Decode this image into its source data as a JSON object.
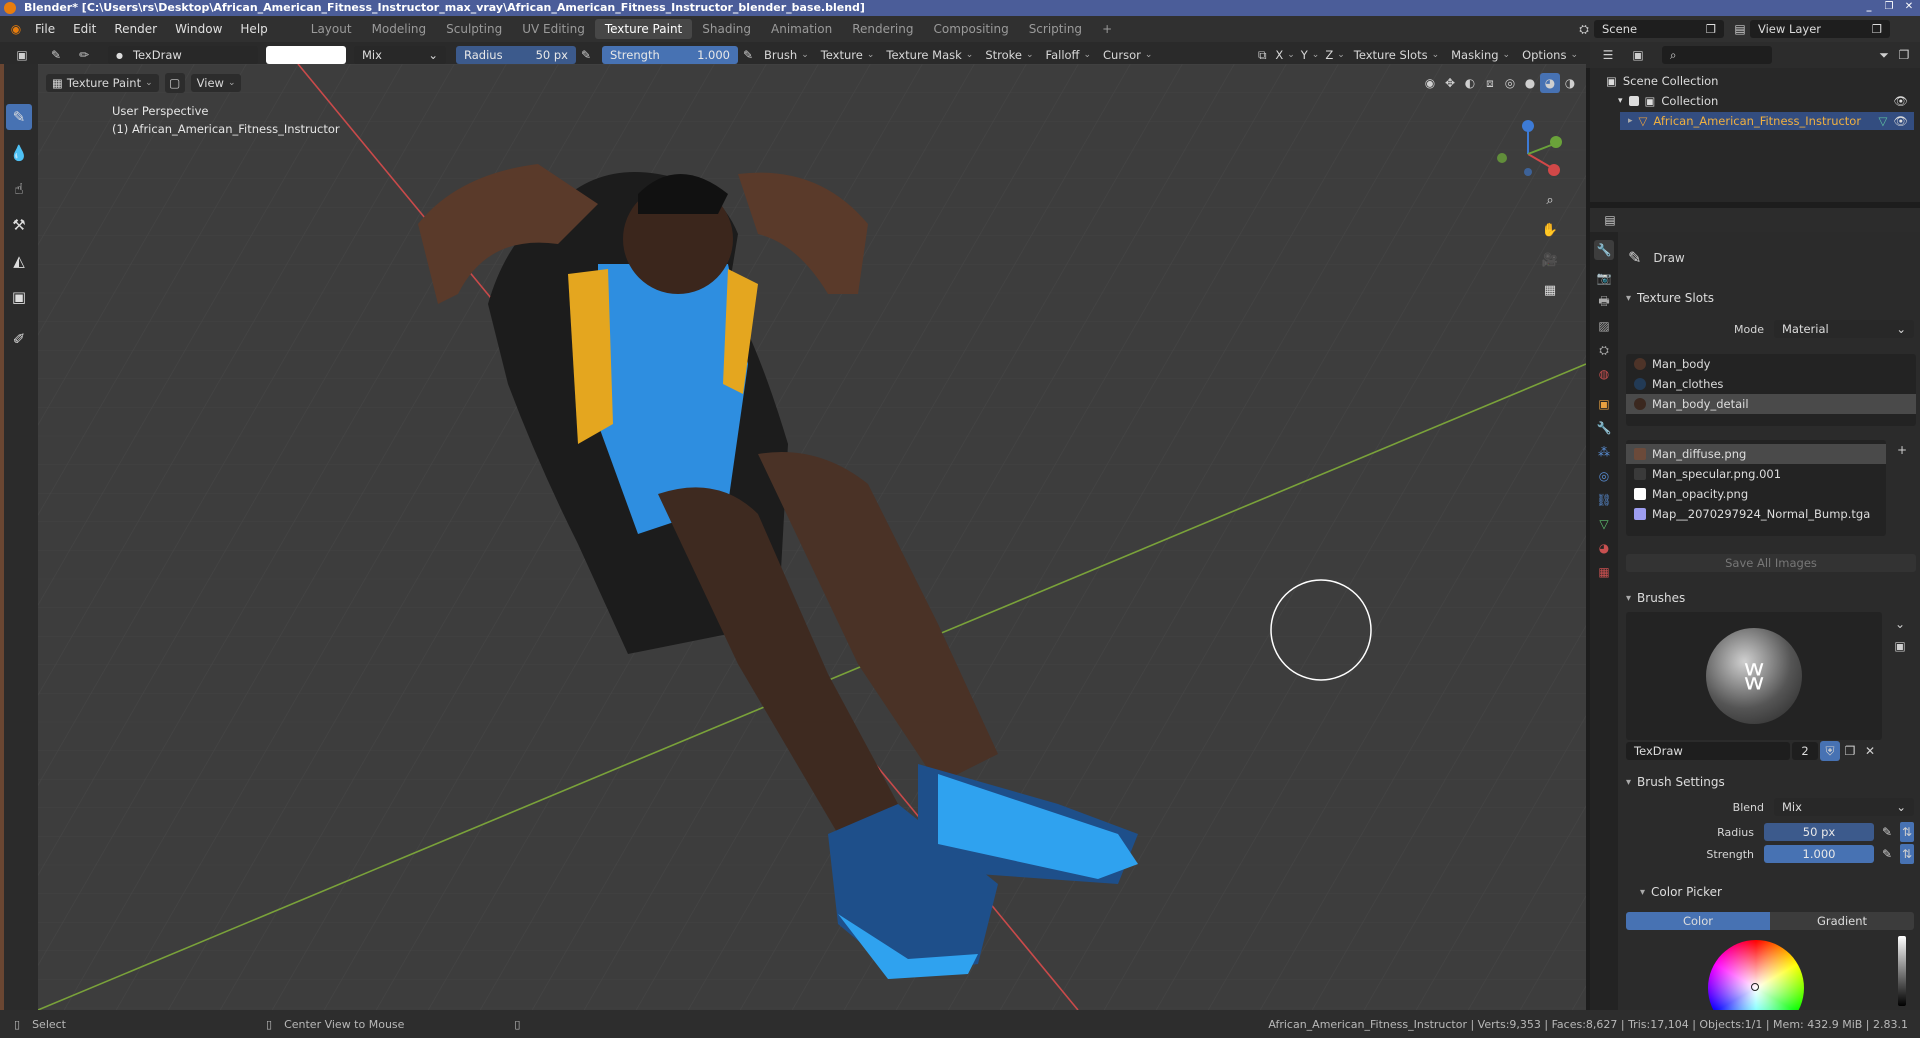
{
  "window": {
    "title": "Blender* [C:\\Users\\rs\\Desktop\\African_American_Fitness_Instructor_max_vray\\African_American_Fitness_Instructor_blender_base.blend]",
    "controls": [
      "_",
      "❐",
      "✕"
    ]
  },
  "menubar": {
    "menus": [
      "File",
      "Edit",
      "Render",
      "Window",
      "Help"
    ],
    "workspaces": [
      "Layout",
      "Modeling",
      "Sculpting",
      "UV Editing",
      "Texture Paint",
      "Shading",
      "Animation",
      "Rendering",
      "Compositing",
      "Scripting"
    ],
    "active_workspace": "Texture Paint",
    "add_tab": "+",
    "scene": "Scene",
    "view_layer": "View Layer"
  },
  "tool_header": {
    "brush_name": "TexDraw",
    "blend": "Mix",
    "radius_label": "Radius",
    "radius_value": "50 px",
    "strength_label": "Strength",
    "strength_value": "1.000",
    "menus": [
      "Brush",
      "Texture",
      "Texture Mask",
      "Stroke",
      "Falloff",
      "Cursor"
    ],
    "axes": [
      "X",
      "Y",
      "Z"
    ],
    "right_menus": [
      "Texture Slots",
      "Masking",
      "Options"
    ]
  },
  "viewport_header": {
    "mode": "Texture Paint",
    "view": "View"
  },
  "viewport": {
    "perspective": "User Perspective",
    "object": "(1) African_American_Fitness_Instructor",
    "gizmo_axes": [
      "X",
      "Y",
      "Z"
    ],
    "colors": {
      "bg": "#3d3d3d",
      "red_axis": "#c94a4a",
      "green_axis": "#7aa23a",
      "grid": "#474747"
    }
  },
  "outliner": {
    "search_placeholder": "",
    "scene_collection": "Scene Collection",
    "collection": "Collection",
    "object": "African_American_Fitness_Instructor"
  },
  "properties": {
    "tool_name": "Draw",
    "texture_slots": {
      "header": "Texture Slots",
      "mode_label": "Mode",
      "mode_value": "Material",
      "materials": [
        "Man_body",
        "Man_clothes",
        "Man_body_detail"
      ],
      "selected_material": 2,
      "images": [
        {
          "name": "Man_diffuse.png",
          "color": "#6b4a3a"
        },
        {
          "name": "Man_specular.png.001",
          "color": "#3a3a3a"
        },
        {
          "name": "Man_opacity.png",
          "color": "#ffffff"
        },
        {
          "name": "Map__2070297924_Normal_Bump.tga",
          "color": "#9d9df0"
        }
      ],
      "selected_image": 0,
      "save_all": "Save All Images"
    },
    "brushes": {
      "header": "Brushes",
      "brush_name": "TexDraw",
      "users": "2"
    },
    "brush_settings": {
      "header": "Brush Settings",
      "blend_label": "Blend",
      "blend_value": "Mix",
      "radius_label": "Radius",
      "radius_value": "50 px",
      "strength_label": "Strength",
      "strength_value": "1.000"
    },
    "color_picker": {
      "header": "Color Picker",
      "tabs": [
        "Color",
        "Gradient"
      ],
      "active_tab": "Color"
    }
  },
  "statusbar": {
    "select": "Select",
    "center_view": "Center View to Mouse",
    "stats": "African_American_Fitness_Instructor | Verts:9,353 | Faces:8,627 | Tris:17,104 | Objects:1/1 | Mem: 432.9 MiB | 2.83.1"
  },
  "accent": "#4772b3"
}
